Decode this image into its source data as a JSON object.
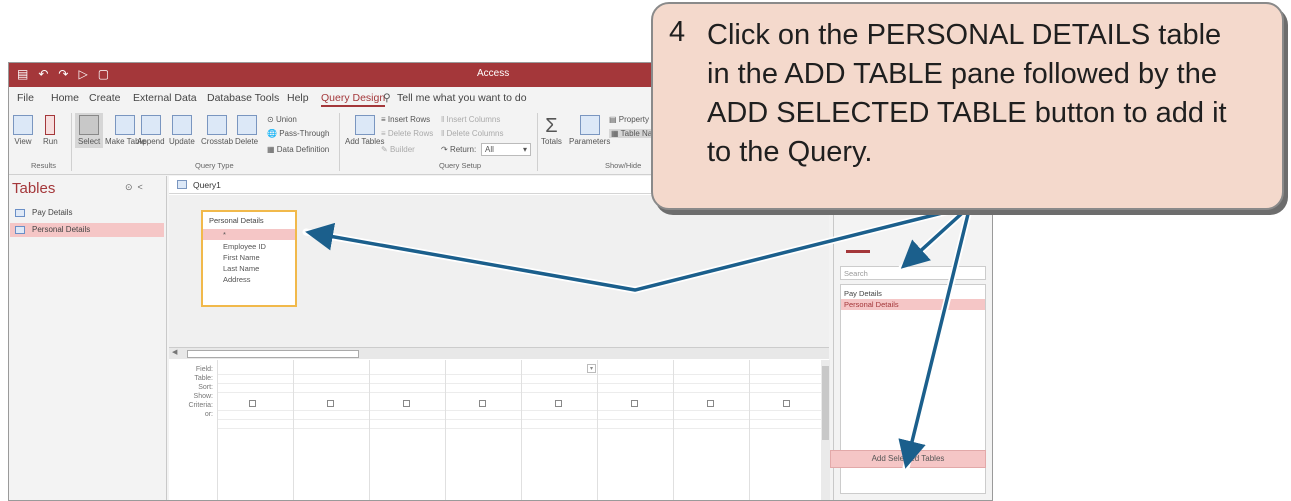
{
  "titlebar": {
    "title": "Access"
  },
  "menu": {
    "tabs": [
      "File",
      "Home",
      "Create",
      "External Data",
      "Database Tools",
      "Help",
      "Query Design"
    ],
    "tell_me": "Tell me what you want to do"
  },
  "ribbon": {
    "results": {
      "view": "View",
      "run": "Run",
      "group": "Results"
    },
    "query_type": {
      "select": "Select",
      "make_table": "Make Table",
      "append": "Append",
      "update": "Update",
      "crosstab": "Crosstab",
      "delete": "Delete",
      "union": "Union",
      "pass_through": "Pass-Through",
      "data_definition": "Data Definition",
      "group": "Query Type"
    },
    "query_setup": {
      "add_tables": "Add Tables",
      "insert_rows": "Insert Rows",
      "delete_rows": "Delete Rows",
      "builder": "Builder",
      "insert_columns": "Insert Columns",
      "delete_columns": "Delete Columns",
      "return_label": "Return:",
      "return_value": "All",
      "group": "Query Setup"
    },
    "show_hide": {
      "totals": "Totals",
      "parameters": "Parameters",
      "property": "Property",
      "table_names": "Table Na",
      "group": "Show/Hide"
    }
  },
  "nav": {
    "header": "Tables",
    "items": [
      {
        "label": "Pay Details"
      },
      {
        "label": "Personal Details"
      }
    ]
  },
  "document": {
    "tab": "Query1",
    "field_list": {
      "title": "Personal Details",
      "fields": [
        "*",
        "Employee ID",
        "First Name",
        "Last Name",
        "Address"
      ]
    },
    "grid_rows": [
      "Field:",
      "Table:",
      "Sort:",
      "Show:",
      "Criteria:",
      "or:"
    ]
  },
  "add_tables_pane": {
    "search_placeholder": "Search",
    "items": [
      "Pay Details",
      "Personal Details"
    ],
    "add_button": "Add Selected Tables"
  },
  "callout": {
    "step": "4",
    "lines": [
      "Click on the PERSONAL DETAILS table",
      "in the ADD TABLE pane followed by the",
      "ADD SELECTED TABLE button to add it",
      "to the Query."
    ]
  },
  "colors": {
    "accent": "#a4373a",
    "callout_bg": "#f4d9cc",
    "arrow": "#1b5f8c",
    "selection": "#f5c6c6"
  }
}
